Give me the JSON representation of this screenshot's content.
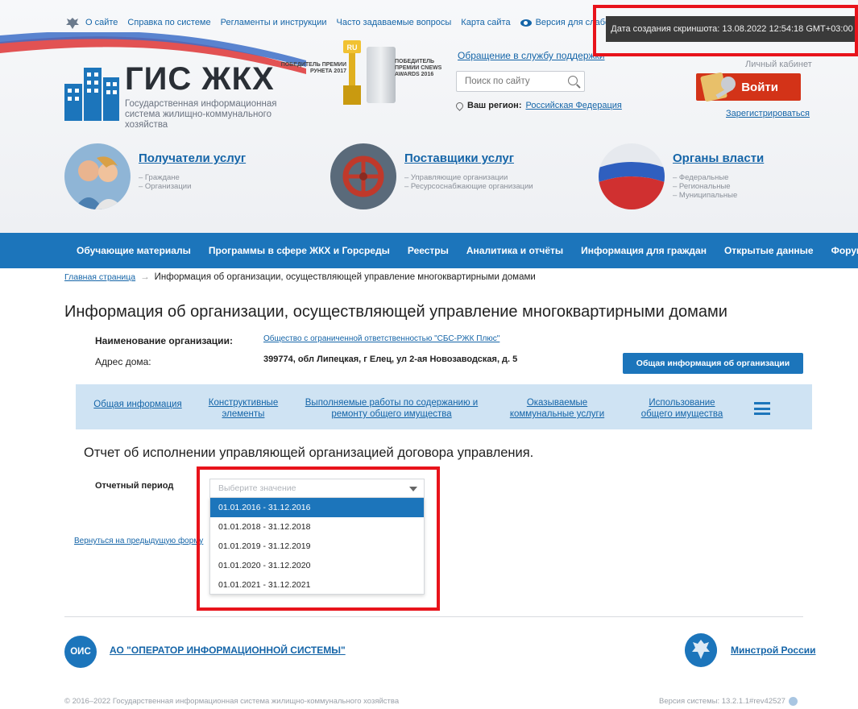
{
  "topnav": {
    "items": [
      "О сайте",
      "Справка по системе",
      "Регламенты и инструкции",
      "Часто задаваемые вопросы",
      "Карта сайта"
    ],
    "low_vision": "Версия для слабовидящих"
  },
  "timestamp": "Дата создания скриншота: 13.08.2022 12:54:18 GMT+03:00",
  "logo": {
    "title": "ГИС ЖКХ",
    "subtitle": "Государственная информационная система жилищно-коммунального хозяйства"
  },
  "awards": {
    "runet": "ПОБЕДИТЕЛЬ ПРЕМИИ РУНЕТА 2017",
    "runet_badge": "RU",
    "cnews": "ПОБЕДИТЕЛЬ ПРЕМИИ CNEWS AWARDS 2016"
  },
  "support_link": "Обращение в службу поддержки",
  "search": {
    "placeholder": "Поиск по сайту"
  },
  "region": {
    "label": "Ваш регион:",
    "value": "Российская Федерация"
  },
  "account": {
    "cabinet_label": "Личный кабинет",
    "login": "Войти",
    "register": "Зарегистрироваться"
  },
  "categories": [
    {
      "title": "Получатели услуг",
      "subs": [
        "– Граждане",
        "– Организации"
      ]
    },
    {
      "title": "Поставщики услуг",
      "subs": [
        "– Управляющие организации",
        "– Ресурсоснабжающие организации"
      ]
    },
    {
      "title": "Органы власти",
      "subs": [
        "– Федеральные",
        "– Региональные",
        "– Муниципальные"
      ]
    }
  ],
  "mainnav": [
    "Обучающие материалы",
    "Программы в сфере ЖКХ и Горсреды",
    "Реестры",
    "Аналитика и отчёты",
    "Информация для граждан",
    "Открытые данные",
    "Форум"
  ],
  "breadcrumb": {
    "home": "Главная страница",
    "arrow": "→",
    "current": "Информация об организации, осуществляющей управление многоквартирными домами"
  },
  "page_title": "Информация об организации, осуществляющей управление многоквартирными домами",
  "org_info": {
    "name_label": "Наименование организации:",
    "name_value": "Общество с ограниченной ответственностью \"СБС-РЖК Плюс\"",
    "address_label": "Адрес дома:",
    "address_value": "399774, обл Липецкая, г Елец, ул 2-ая Новозаводская, д. 5",
    "general_button": "Общая информация об организации"
  },
  "tabs": [
    {
      "l1": "Общая информация",
      "l2": ""
    },
    {
      "l1": "Конструктивные",
      "l2": "элементы"
    },
    {
      "l1": "Выполняемые работы по содержанию и",
      "l2": "ремонту общего имущества"
    },
    {
      "l1": "Оказываемые",
      "l2": "коммунальные услуги"
    },
    {
      "l1": "Использование",
      "l2": "общего имущества"
    }
  ],
  "report": {
    "title": "Отчет об исполнении управляющей организацией договора управления.",
    "period_label": "Отчетный период",
    "placeholder": "Выберите значение",
    "options": [
      "01.01.2016 - 31.12.2016",
      "01.01.2018 - 31.12.2018",
      "01.01.2019 - 31.12.2019",
      "01.01.2020 - 31.12.2020",
      "01.01.2021 - 31.12.2021"
    ],
    "selected_index": 0,
    "back_link": "Вернуться на предыдущую форму"
  },
  "footer": {
    "ois_badge": "ОИС",
    "ois_link": "АО \"ОПЕРАТОР ИНФОРМАЦИОННОЙ СИСТЕМЫ\"",
    "ministry_link": "Минстрой России",
    "copyright": "© 2016–2022 Государственная информационная система жилищно-коммунального хозяйства",
    "version": "Версия системы: 13.2.1.1#rev42527"
  },
  "colors": {
    "primary": "#1c75bb",
    "link": "#1565a8",
    "login": "#d33318",
    "highlight_frame": "#e8131b",
    "tabs_bg": "#cfe3f3"
  }
}
